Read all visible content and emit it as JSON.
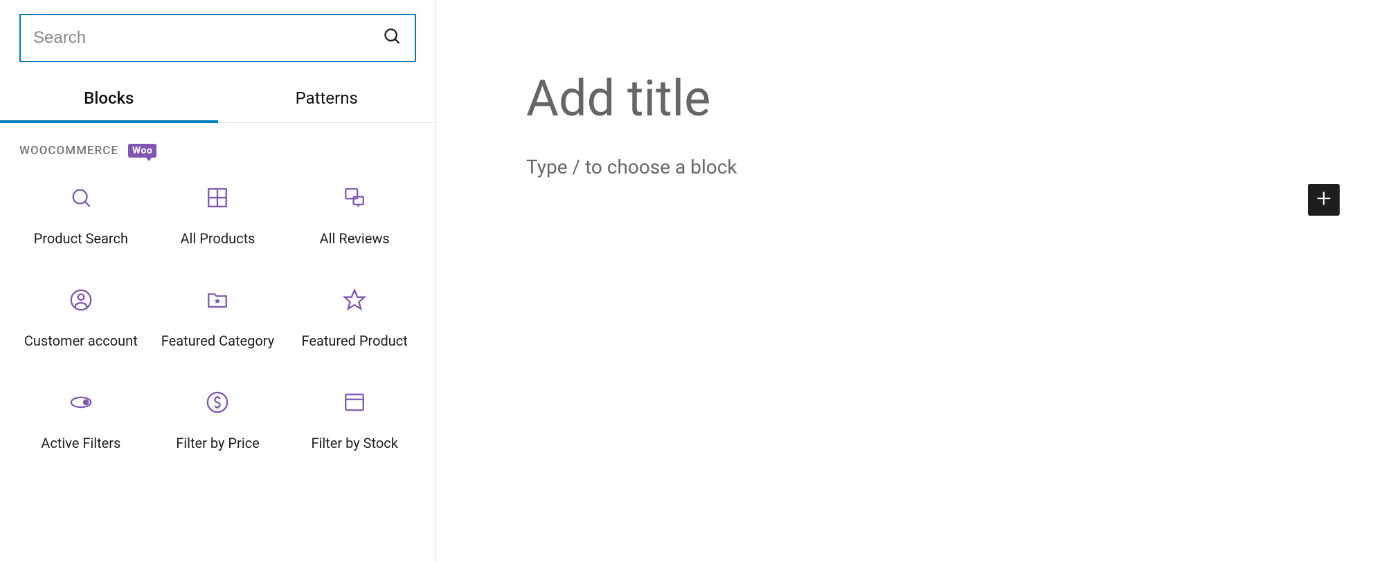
{
  "sidebar": {
    "search": {
      "placeholder": "Search"
    },
    "tabs": [
      {
        "label": "Blocks",
        "active": true
      },
      {
        "label": "Patterns",
        "active": false
      }
    ],
    "category": {
      "label": "WOOCOMMERCE",
      "badge": "Woo"
    },
    "blocks": [
      {
        "label": "Product Search",
        "icon": "search"
      },
      {
        "label": "All Products",
        "icon": "grid"
      },
      {
        "label": "All Reviews",
        "icon": "reviews"
      },
      {
        "label": "Customer account",
        "icon": "user-circle"
      },
      {
        "label": "Featured Category",
        "icon": "folder-star"
      },
      {
        "label": "Featured Product",
        "icon": "star"
      },
      {
        "label": "Active Filters",
        "icon": "toggle"
      },
      {
        "label": "Filter by Price",
        "icon": "dollar"
      },
      {
        "label": "Filter by Stock",
        "icon": "box"
      }
    ]
  },
  "editor": {
    "title_placeholder": "Add title",
    "block_prompt": "Type / to choose a block"
  }
}
